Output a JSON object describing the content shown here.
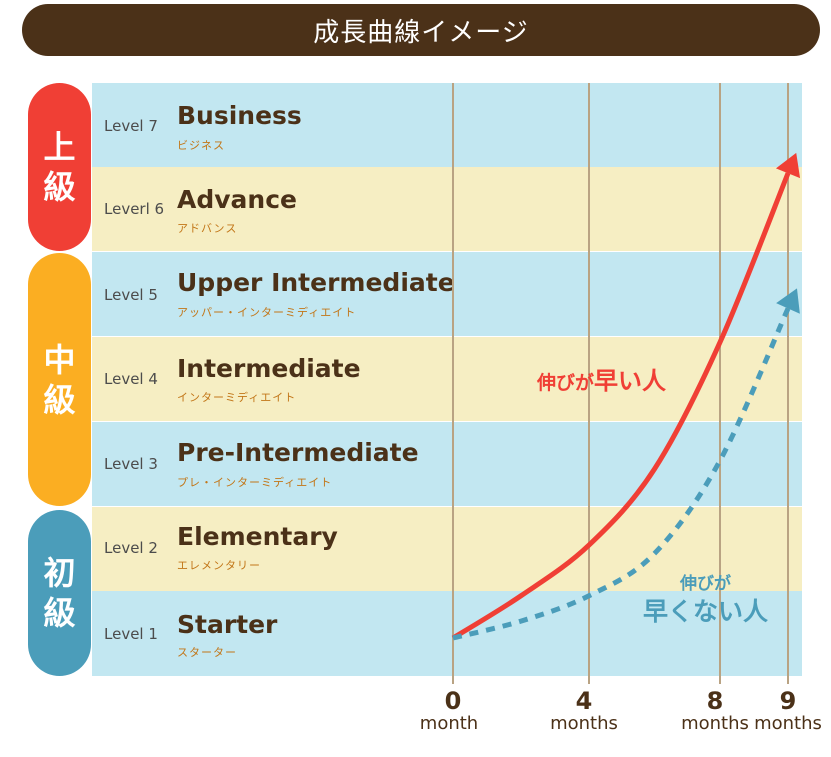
{
  "title": "成長曲線イメージ",
  "tiers": [
    {
      "label_top": "上",
      "label_bottom": "級",
      "color": "#f03f35"
    },
    {
      "label_top": "中",
      "label_bottom": "級",
      "color": "#fbae22"
    },
    {
      "label_top": "初",
      "label_bottom": "級",
      "color": "#4b9dba"
    }
  ],
  "levels": [
    {
      "level": "Level 7",
      "name": "Business",
      "kana": "ビジネス"
    },
    {
      "level": "Leverl 6",
      "name": "Advance",
      "kana": "アドバンス"
    },
    {
      "level": "Level 5",
      "name": "Upper Intermediate",
      "kana": "アッパー・インターミディエイト"
    },
    {
      "level": "Level 4",
      "name": "Intermediate",
      "kana": "インターミディエイト"
    },
    {
      "level": "Level 3",
      "name": "Pre-Intermediate",
      "kana": "プレ・インターミディエイト"
    },
    {
      "level": "Level 2",
      "name": "Elementary",
      "kana": "エレメンタリー"
    },
    {
      "level": "Level 1",
      "name": "Starter",
      "kana": "スターター"
    }
  ],
  "x_axis": [
    {
      "value": "0",
      "unit": "month"
    },
    {
      "value": "4",
      "unit": "months"
    },
    {
      "value": "8",
      "unit": "months"
    },
    {
      "value": "9",
      "unit": "months"
    }
  ],
  "annotations": {
    "fast_small": "伸びが",
    "fast_big": "早い人",
    "slow_line1": "伸びが",
    "slow_line2": "早くない人"
  },
  "colors": {
    "brown": "#4b3118",
    "fast": "#f03f35",
    "slow": "#4b9dba",
    "band_blue": "#c2e7f1",
    "band_cream": "#f6eec3"
  },
  "chart_data": {
    "type": "line",
    "title": "成長曲線イメージ",
    "xlabel": "months",
    "ylabel": "level",
    "x_ticks": [
      0,
      4,
      8,
      9
    ],
    "y_ticks": [
      "Level 1",
      "Level 2",
      "Level 3",
      "Level 4",
      "Level 5",
      "Level 6",
      "Level 7"
    ],
    "xlim": [
      0,
      9
    ],
    "ylim": [
      1,
      7
    ],
    "series": [
      {
        "name": "伸びが早い人",
        "style": "solid",
        "color": "#f03f35",
        "x": [
          0,
          2,
          4,
          6,
          8,
          9
        ],
        "y": [
          1,
          1.5,
          2.1,
          3.0,
          4.5,
          6.5
        ]
      },
      {
        "name": "伸びが早くない人",
        "style": "dashed",
        "color": "#4b9dba",
        "x": [
          0,
          2,
          4,
          6,
          8,
          9
        ],
        "y": [
          1,
          1.2,
          1.5,
          2.0,
          3.1,
          4.9
        ]
      }
    ]
  }
}
